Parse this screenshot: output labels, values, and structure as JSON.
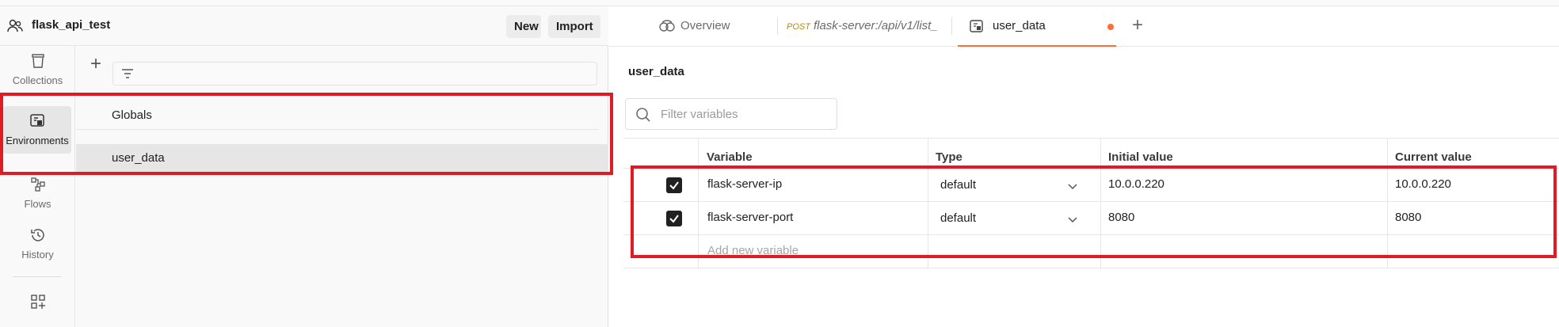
{
  "workspace": {
    "name": "flask_api_test",
    "new_label": "New",
    "import_label": "Import"
  },
  "sidebar": {
    "items": [
      {
        "label": "Collections"
      },
      {
        "label": "Environments"
      },
      {
        "label": "Flows"
      },
      {
        "label": "History"
      }
    ]
  },
  "environments": {
    "items": [
      "Globals",
      "user_data"
    ]
  },
  "tabs": {
    "overview": "Overview",
    "request_method": "POST",
    "request_label": "flask-server:/api/v1/list_",
    "active": "user_data"
  },
  "editor": {
    "title": "user_data",
    "filter_placeholder": "Filter variables",
    "columns": [
      "Variable",
      "Type",
      "Initial value",
      "Current value"
    ],
    "rows": [
      {
        "checked": true,
        "variable": "flask-server-ip",
        "type": "default",
        "initial": "10.0.0.220",
        "current": "10.0.0.220"
      },
      {
        "checked": true,
        "variable": "flask-server-port",
        "type": "default",
        "initial": "8080",
        "current": "8080"
      }
    ],
    "add_placeholder": "Add new variable"
  },
  "colors": {
    "accent": "#ff6c37",
    "annotation": "#e01b24"
  }
}
